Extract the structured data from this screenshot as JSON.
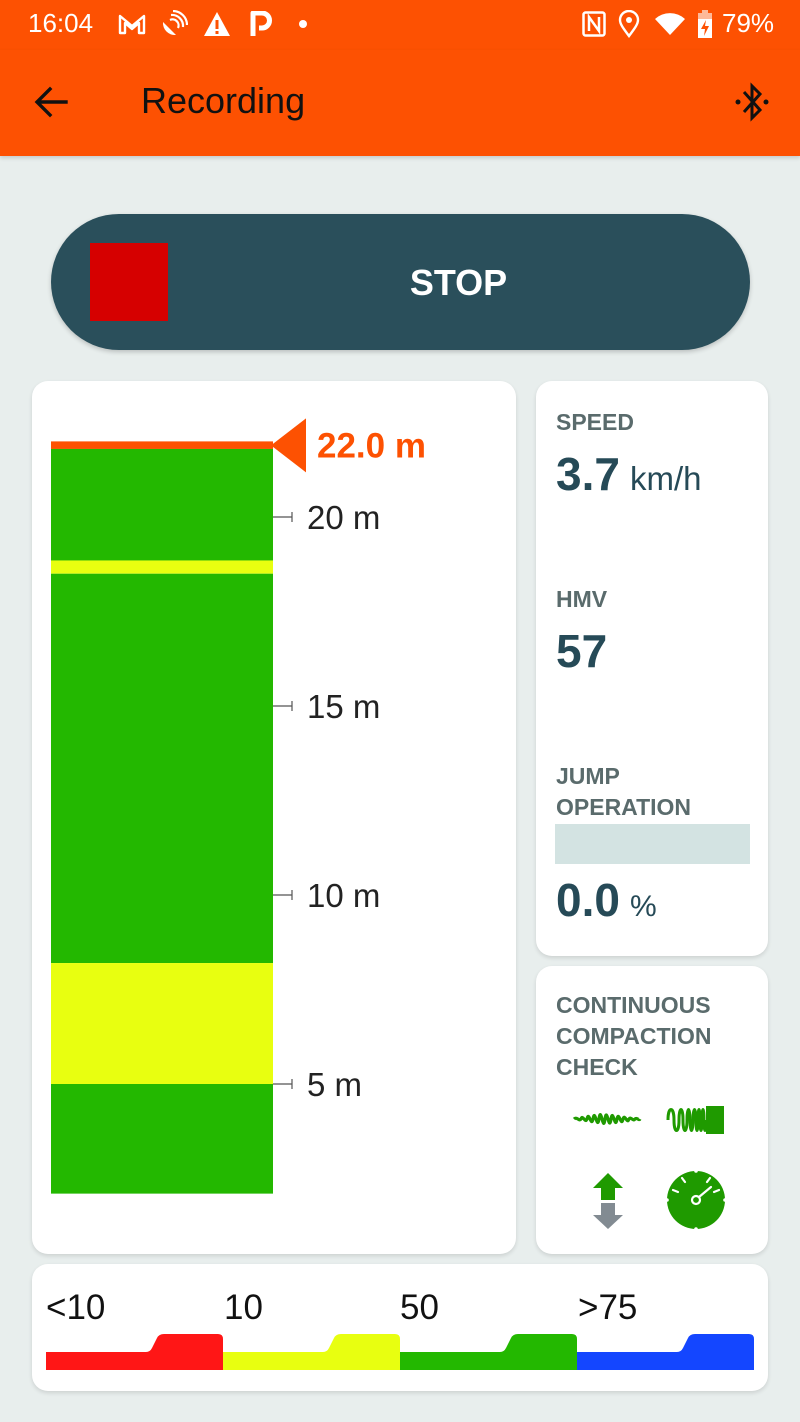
{
  "status_bar": {
    "time": "16:04",
    "left_icons": [
      "gmail-icon",
      "satellite-dish-icon",
      "warning-icon",
      "parking-icon",
      "notification-dot-icon"
    ],
    "right_icons": [
      "nfc-icon",
      "location-icon",
      "wifi-icon",
      "battery-charging-icon"
    ],
    "battery_percent": "79%"
  },
  "app_bar": {
    "title": "Recording",
    "back_icon": "arrow-left-icon",
    "action_icon": "bluetooth-connected-icon"
  },
  "stop_button": {
    "label": "STOP",
    "icon": "stop-square-icon",
    "colors": {
      "background": "#2a4f5b",
      "square": "#d60000"
    }
  },
  "depth_profile": {
    "current_depth_label": "22.0 m",
    "current_depth": 22.0,
    "bottom_depth": 2.1,
    "tick_labels": [
      {
        "value": 20,
        "label": "20 m"
      },
      {
        "value": 15,
        "label": "15 m"
      },
      {
        "value": 10,
        "label": "10 m"
      },
      {
        "value": 5,
        "label": "5 m"
      }
    ],
    "segments": [
      {
        "from": 22.0,
        "to": 21.8,
        "color": "#fd5102",
        "class": "marker"
      },
      {
        "from": 21.8,
        "to": 18.85,
        "color": "#23b800",
        "class": "50"
      },
      {
        "from": 18.85,
        "to": 18.5,
        "color": "#e8ff10",
        "class": "10"
      },
      {
        "from": 18.5,
        "to": 8.2,
        "color": "#23b800",
        "class": "50"
      },
      {
        "from": 8.2,
        "to": 5.0,
        "color": "#e8ff10",
        "class": "10"
      },
      {
        "from": 5.0,
        "to": 2.1,
        "color": "#23b800",
        "class": "50"
      }
    ],
    "marker_color": "#fd5102"
  },
  "metrics": {
    "speed": {
      "label": "SPEED",
      "value": "3.7",
      "unit": "km/h"
    },
    "hmv": {
      "label": "HMV",
      "value": "57"
    },
    "jump_operation": {
      "label_line1": "JUMP",
      "label_line2": "OPERATION",
      "value": "0.0",
      "unit": "%",
      "fraction": 0.0
    }
  },
  "ccc": {
    "label_line1": "CONTINUOUS",
    "label_line2": "COMPACTION",
    "label_line3": "CHECK",
    "icons": [
      "vibration-wave-icon",
      "compaction-wave-icon",
      "up-down-arrow-icon",
      "gauge-icon"
    ],
    "accent": "#1f9a00"
  },
  "legend": {
    "items": [
      {
        "label": "<10",
        "color": "#ff1616"
      },
      {
        "label": "10",
        "color": "#e8ff10"
      },
      {
        "label": "50",
        "color": "#23b800"
      },
      {
        "label": ">75",
        "color": "#1446ff"
      }
    ]
  }
}
